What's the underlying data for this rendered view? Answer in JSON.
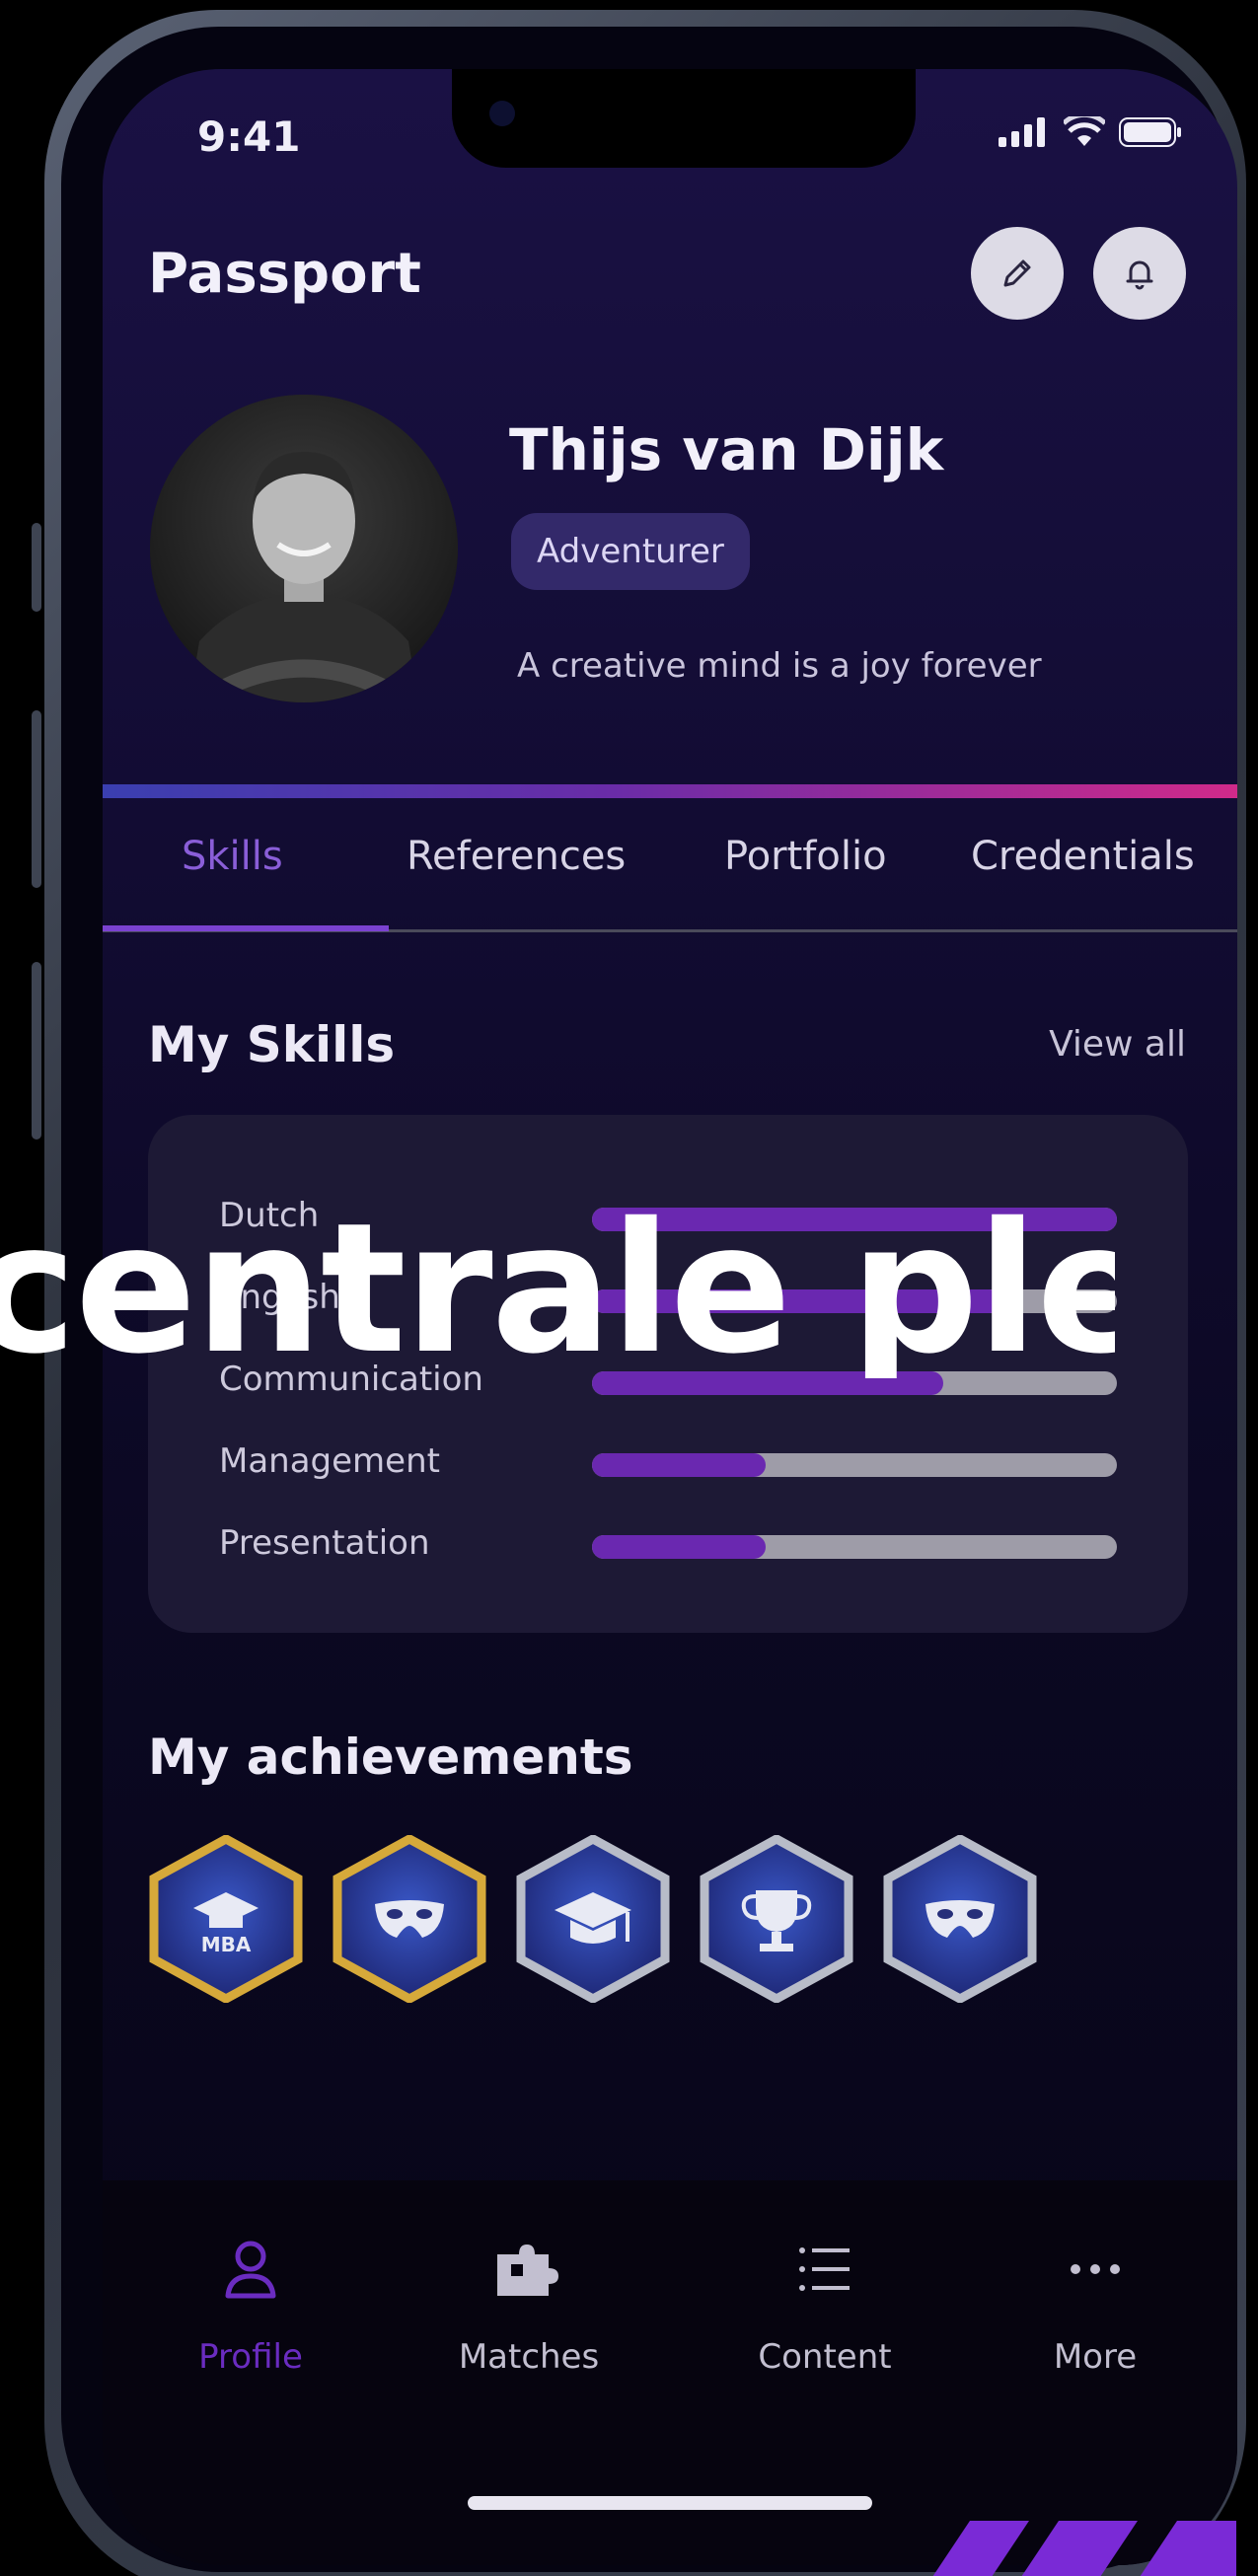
{
  "status_bar": {
    "time": "9:41"
  },
  "header": {
    "title": "Passport"
  },
  "profile": {
    "name": "Thijs van Dijk",
    "badge": "Adventurer",
    "bio": "A creative mind is a joy forever"
  },
  "tabs": [
    {
      "label": "Skills",
      "active": true
    },
    {
      "label": "References",
      "active": false
    },
    {
      "label": "Portfolio",
      "active": false
    },
    {
      "label": "Credentials",
      "active": false
    }
  ],
  "skills_section": {
    "title": "My Skills",
    "view_all": "View all",
    "items": [
      {
        "label": "Dutch",
        "level": 1.0
      },
      {
        "label": "English",
        "level": 0.78
      },
      {
        "label": "Communication",
        "level": 0.67
      },
      {
        "label": "Management",
        "level": 0.33
      },
      {
        "label": "Presentation",
        "level": 0.33
      }
    ]
  },
  "achievements_section": {
    "title": "My achievements",
    "badges": [
      {
        "icon": "mba-cap-icon",
        "text": "MBA",
        "border": "gold"
      },
      {
        "icon": "mask-icon",
        "border": "gold"
      },
      {
        "icon": "graduation-cap-icon",
        "border": "silver"
      },
      {
        "icon": "trophy-icon",
        "border": "silver"
      },
      {
        "icon": "mask-icon",
        "border": "silver"
      }
    ]
  },
  "bottom_nav": [
    {
      "label": "Profile",
      "icon": "person-icon",
      "active": true
    },
    {
      "label": "Matches",
      "icon": "puzzle-icon",
      "active": false
    },
    {
      "label": "Content",
      "icon": "list-icon",
      "active": false
    },
    {
      "label": "More",
      "icon": "more-dots-icon",
      "active": false
    }
  ],
  "overlay_caption": "centrale plek",
  "colors": {
    "accent": "#7a42d0",
    "skill_fill": "#6a28b0",
    "skill_track": "#9e9ca8",
    "gold": "#d6a93a",
    "silver": "#b8bcc8"
  }
}
